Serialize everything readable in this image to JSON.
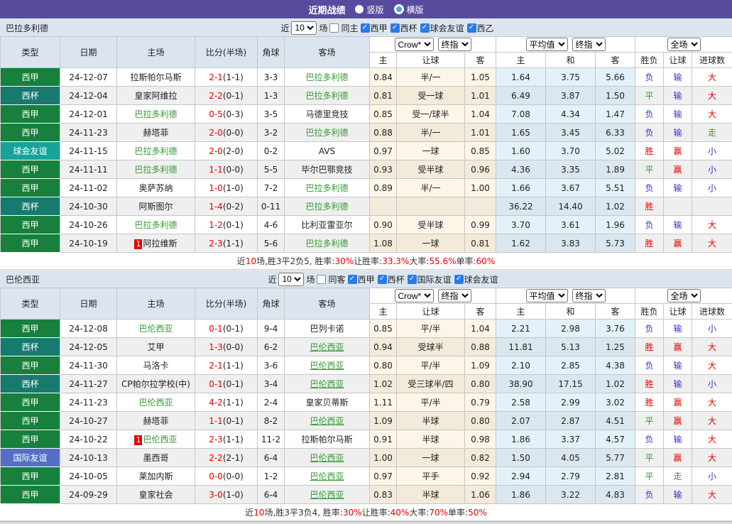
{
  "topbar": {
    "title": "近期战绩",
    "vertical_label": "竖版",
    "horizontal_label": "横版"
  },
  "colors": {
    "accent": "#574b9e",
    "panel": "#dce5ef",
    "xijia": "#16803c",
    "xibei": "#177a6e",
    "qiuhui": "#18a39a",
    "guoji": "#5470c6",
    "team": "#339933",
    "score": "#e60000",
    "win": "#e60000",
    "draw": "#339933",
    "lose": "#3333cc",
    "hwin": "#e60000",
    "hlose": "#3333cc",
    "push": "#339933",
    "over": "#e60000",
    "under": "#3333cc",
    "checkbox": "#2b7be4"
  },
  "tables": [
    {
      "team": "巴拉多利德",
      "filter": {
        "near_label": "近",
        "matches_count": "10",
        "matches_label": "场",
        "same_side_label": "同主",
        "same_side_checked": false,
        "leagues": [
          "西甲",
          "西杯",
          "球会友谊",
          "西乙"
        ]
      },
      "header": {
        "type": "类型",
        "date": "日期",
        "home": "主场",
        "score": "比分(半场)",
        "corner": "角球",
        "away": "客场",
        "crow_select": "Crow*",
        "final_select": "终指",
        "avg_select": "平均值",
        "final_select2": "终指",
        "full_select": "全场",
        "crow_home": "主",
        "crow_handicap": "让球",
        "crow_away": "客",
        "avg_home": "主",
        "avg_draw": "和",
        "avg_away": "客",
        "wdl": "胜负",
        "handicap_result": "让球",
        "goals": "进球数"
      },
      "rows": [
        {
          "type": "西甲",
          "type_key": "xijia",
          "date": "24-12-07",
          "home": "拉斯帕尔马斯",
          "home_hl": false,
          "home_badge": "",
          "score": "2-1",
          "half": "(1-1)",
          "corner": "3-3",
          "away": "巴拉多利德",
          "away_hl": true,
          "away_ul": false,
          "crow_home": "0.84",
          "crow_hcap": "半/一",
          "crow_away": "1.05",
          "avg_home": "1.64",
          "avg_draw": "3.75",
          "avg_away": "5.66",
          "wdl": "负",
          "wdl_key": "lose",
          "hcap": "输",
          "hcap_key": "hlose",
          "goals": "大",
          "goals_key": "over"
        },
        {
          "type": "西杯",
          "type_key": "xibei",
          "date": "24-12-04",
          "home": "皇家阿维拉",
          "home_hl": false,
          "home_badge": "",
          "score": "2-2",
          "half": "(0-1)",
          "corner": "1-3",
          "away": "巴拉多利德",
          "away_hl": true,
          "away_ul": false,
          "crow_home": "0.81",
          "crow_hcap": "受一球",
          "crow_away": "1.01",
          "avg_home": "6.49",
          "avg_draw": "3.87",
          "avg_away": "1.50",
          "wdl": "平",
          "wdl_key": "draw",
          "hcap": "输",
          "hcap_key": "hlose",
          "goals": "大",
          "goals_key": "over"
        },
        {
          "type": "西甲",
          "type_key": "xijia",
          "date": "24-12-01",
          "home": "巴拉多利德",
          "home_hl": true,
          "home_badge": "",
          "score": "0-5",
          "half": "(0-3)",
          "corner": "3-5",
          "away": "马德里竞技",
          "away_hl": false,
          "away_ul": false,
          "crow_home": "0.85",
          "crow_hcap": "受一/球半",
          "crow_away": "1.04",
          "avg_home": "7.08",
          "avg_draw": "4.34",
          "avg_away": "1.47",
          "wdl": "负",
          "wdl_key": "lose",
          "hcap": "输",
          "hcap_key": "hlose",
          "goals": "大",
          "goals_key": "over"
        },
        {
          "type": "西甲",
          "type_key": "xijia",
          "date": "24-11-23",
          "home": "赫塔菲",
          "home_hl": false,
          "home_badge": "",
          "score": "2-0",
          "half": "(0-0)",
          "corner": "3-2",
          "away": "巴拉多利德",
          "away_hl": true,
          "away_ul": false,
          "crow_home": "0.88",
          "crow_hcap": "半/一",
          "crow_away": "1.01",
          "avg_home": "1.65",
          "avg_draw": "3.45",
          "avg_away": "6.33",
          "wdl": "负",
          "wdl_key": "lose",
          "hcap": "输",
          "hcap_key": "hlose",
          "goals": "走",
          "goals_key": "push"
        },
        {
          "type": "球会友谊",
          "type_key": "qiuhui",
          "date": "24-11-15",
          "home": "巴拉多利德",
          "home_hl": true,
          "home_badge": "",
          "score": "2-0",
          "half": "(2-0)",
          "corner": "0-2",
          "away": "AVS",
          "away_hl": false,
          "away_ul": false,
          "crow_home": "0.97",
          "crow_hcap": "一球",
          "crow_away": "0.85",
          "avg_home": "1.60",
          "avg_draw": "3.70",
          "avg_away": "5.02",
          "wdl": "胜",
          "wdl_key": "win",
          "hcap": "赢",
          "hcap_key": "hwin",
          "goals": "小",
          "goals_key": "under"
        },
        {
          "type": "西甲",
          "type_key": "xijia",
          "date": "24-11-11",
          "home": "巴拉多利德",
          "home_hl": true,
          "home_badge": "",
          "score": "1-1",
          "half": "(0-0)",
          "corner": "5-5",
          "away": "毕尔巴鄂竞技",
          "away_hl": false,
          "away_ul": false,
          "crow_home": "0.93",
          "crow_hcap": "受半球",
          "crow_away": "0.96",
          "avg_home": "4.36",
          "avg_draw": "3.35",
          "avg_away": "1.89",
          "wdl": "平",
          "wdl_key": "draw",
          "hcap": "赢",
          "hcap_key": "hwin",
          "goals": "小",
          "goals_key": "under"
        },
        {
          "type": "西甲",
          "type_key": "xijia",
          "date": "24-11-02",
          "home": "奥萨苏纳",
          "home_hl": false,
          "home_badge": "",
          "score": "1-0",
          "half": "(1-0)",
          "corner": "7-2",
          "away": "巴拉多利德",
          "away_hl": true,
          "away_ul": false,
          "crow_home": "0.89",
          "crow_hcap": "半/一",
          "crow_away": "1.00",
          "avg_home": "1.66",
          "avg_draw": "3.67",
          "avg_away": "5.51",
          "wdl": "负",
          "wdl_key": "lose",
          "hcap": "输",
          "hcap_key": "hlose",
          "goals": "小",
          "goals_key": "under"
        },
        {
          "type": "西杯",
          "type_key": "xibei",
          "date": "24-10-30",
          "home": "阿斯图尔",
          "home_hl": false,
          "home_badge": "",
          "score": "1-4",
          "half": "(0-2)",
          "corner": "0-11",
          "away": "巴拉多利德",
          "away_hl": true,
          "away_ul": false,
          "crow_home": "",
          "crow_hcap": "",
          "crow_away": "",
          "avg_home": "36.22",
          "avg_draw": "14.40",
          "avg_away": "1.02",
          "wdl": "胜",
          "wdl_key": "win",
          "hcap": "",
          "hcap_key": "",
          "goals": "",
          "goals_key": ""
        },
        {
          "type": "西甲",
          "type_key": "xijia",
          "date": "24-10-26",
          "home": "巴拉多利德",
          "home_hl": true,
          "home_badge": "",
          "score": "1-2",
          "half": "(0-1)",
          "corner": "4-6",
          "away": "比利亚雷亚尔",
          "away_hl": false,
          "away_ul": false,
          "crow_home": "0.90",
          "crow_hcap": "受半球",
          "crow_away": "0.99",
          "avg_home": "3.70",
          "avg_draw": "3.61",
          "avg_away": "1.96",
          "wdl": "负",
          "wdl_key": "lose",
          "hcap": "输",
          "hcap_key": "hlose",
          "goals": "大",
          "goals_key": "over"
        },
        {
          "type": "西甲",
          "type_key": "xijia",
          "date": "24-10-19",
          "home": "阿拉维斯",
          "home_hl": false,
          "home_badge": "1",
          "score": "2-3",
          "half": "(1-1)",
          "corner": "5-6",
          "away": "巴拉多利德",
          "away_hl": true,
          "away_ul": false,
          "crow_home": "1.08",
          "crow_hcap": "一球",
          "crow_away": "0.81",
          "avg_home": "1.62",
          "avg_draw": "3.83",
          "avg_away": "5.73",
          "wdl": "胜",
          "wdl_key": "win",
          "hcap": "赢",
          "hcap_key": "hwin",
          "goals": "大",
          "goals_key": "over"
        }
      ],
      "summary": [
        {
          "text": "近",
          "red": false
        },
        {
          "text": "10",
          "red": true
        },
        {
          "text": "场,胜3平2负5, 胜率:",
          "red": false
        },
        {
          "text": "30%",
          "red": true
        },
        {
          "text": " 让胜率:",
          "red": false
        },
        {
          "text": "33.3%",
          "red": true
        },
        {
          "text": " 大率:",
          "red": false
        },
        {
          "text": "55.6%",
          "red": true
        },
        {
          "text": " 单率:",
          "red": false
        },
        {
          "text": "60%",
          "red": true
        }
      ]
    },
    {
      "team": "巴伦西亚",
      "filter": {
        "near_label": "近",
        "matches_count": "10",
        "matches_label": "场",
        "same_side_label": "同客",
        "same_side_checked": false,
        "leagues": [
          "西甲",
          "西杯",
          "国际友谊",
          "球会友谊"
        ]
      },
      "header": {
        "type": "类型",
        "date": "日期",
        "home": "主场",
        "score": "比分(半场)",
        "corner": "角球",
        "away": "客场",
        "crow_select": "Crow*",
        "final_select": "终指",
        "avg_select": "平均值",
        "final_select2": "终指",
        "full_select": "全场",
        "crow_home": "主",
        "crow_handicap": "让球",
        "crow_away": "客",
        "avg_home": "主",
        "avg_draw": "和",
        "avg_away": "客",
        "wdl": "胜负",
        "handicap_result": "让球",
        "goals": "进球数"
      },
      "rows": [
        {
          "type": "西甲",
          "type_key": "xijia",
          "date": "24-12-08",
          "home": "巴伦西亚",
          "home_hl": true,
          "home_badge": "",
          "score": "0-1",
          "half": "(0-1)",
          "corner": "9-4",
          "away": "巴列卡诺",
          "away_hl": false,
          "away_ul": false,
          "crow_home": "0.85",
          "crow_hcap": "平/半",
          "crow_away": "1.04",
          "avg_home": "2.21",
          "avg_draw": "2.98",
          "avg_away": "3.76",
          "wdl": "负",
          "wdl_key": "lose",
          "hcap": "输",
          "hcap_key": "hlose",
          "goals": "小",
          "goals_key": "under"
        },
        {
          "type": "西杯",
          "type_key": "xibei",
          "date": "24-12-05",
          "home": "艾甲",
          "home_hl": false,
          "home_badge": "",
          "score": "1-3",
          "half": "(0-0)",
          "corner": "6-2",
          "away": "巴伦西亚",
          "away_hl": true,
          "away_ul": true,
          "crow_home": "0.94",
          "crow_hcap": "受球半",
          "crow_away": "0.88",
          "avg_home": "11.81",
          "avg_draw": "5.13",
          "avg_away": "1.25",
          "wdl": "胜",
          "wdl_key": "win",
          "hcap": "赢",
          "hcap_key": "hwin",
          "goals": "大",
          "goals_key": "over"
        },
        {
          "type": "西甲",
          "type_key": "xijia",
          "date": "24-11-30",
          "home": "马洛卡",
          "home_hl": false,
          "home_badge": "",
          "score": "2-1",
          "half": "(1-1)",
          "corner": "3-6",
          "away": "巴伦西亚",
          "away_hl": true,
          "away_ul": true,
          "crow_home": "0.80",
          "crow_hcap": "平/半",
          "crow_away": "1.09",
          "avg_home": "2.10",
          "avg_draw": "2.85",
          "avg_away": "4.38",
          "wdl": "负",
          "wdl_key": "lose",
          "hcap": "输",
          "hcap_key": "hlose",
          "goals": "大",
          "goals_key": "over"
        },
        {
          "type": "西杯",
          "type_key": "xibei",
          "date": "24-11-27",
          "home": "CP帕尔拉学校(中)",
          "home_hl": false,
          "home_badge": "",
          "score": "0-1",
          "half": "(0-1)",
          "corner": "3-4",
          "away": "巴伦西亚",
          "away_hl": true,
          "away_ul": true,
          "crow_home": "1.02",
          "crow_hcap": "受三球半/四",
          "crow_away": "0.80",
          "avg_home": "38.90",
          "avg_draw": "17.15",
          "avg_away": "1.02",
          "wdl": "胜",
          "wdl_key": "win",
          "hcap": "输",
          "hcap_key": "hlose",
          "goals": "小",
          "goals_key": "under"
        },
        {
          "type": "西甲",
          "type_key": "xijia",
          "date": "24-11-23",
          "home": "巴伦西亚",
          "home_hl": true,
          "home_badge": "",
          "score": "4-2",
          "half": "(1-1)",
          "corner": "2-4",
          "away": "皇家贝蒂斯",
          "away_hl": false,
          "away_ul": false,
          "crow_home": "1.11",
          "crow_hcap": "平/半",
          "crow_away": "0.79",
          "avg_home": "2.58",
          "avg_draw": "2.99",
          "avg_away": "3.02",
          "wdl": "胜",
          "wdl_key": "win",
          "hcap": "赢",
          "hcap_key": "hwin",
          "goals": "大",
          "goals_key": "over"
        },
        {
          "type": "西甲",
          "type_key": "xijia",
          "date": "24-10-27",
          "home": "赫塔菲",
          "home_hl": false,
          "home_badge": "",
          "score": "1-1",
          "half": "(0-1)",
          "corner": "8-2",
          "away": "巴伦西亚",
          "away_hl": true,
          "away_ul": true,
          "crow_home": "1.09",
          "crow_hcap": "半球",
          "crow_away": "0.80",
          "avg_home": "2.07",
          "avg_draw": "2.87",
          "avg_away": "4.51",
          "wdl": "平",
          "wdl_key": "draw",
          "hcap": "赢",
          "hcap_key": "hwin",
          "goals": "大",
          "goals_key": "over"
        },
        {
          "type": "西甲",
          "type_key": "xijia",
          "date": "24-10-22",
          "home": "巴伦西亚",
          "home_hl": true,
          "home_badge": "1",
          "score": "2-3",
          "half": "(1-1)",
          "corner": "11-2",
          "away": "拉斯帕尔马斯",
          "away_hl": false,
          "away_ul": false,
          "crow_home": "0.91",
          "crow_hcap": "半球",
          "crow_away": "0.98",
          "avg_home": "1.86",
          "avg_draw": "3.37",
          "avg_away": "4.57",
          "wdl": "负",
          "wdl_key": "lose",
          "hcap": "输",
          "hcap_key": "hlose",
          "goals": "大",
          "goals_key": "over"
        },
        {
          "type": "国际友谊",
          "type_key": "guoji",
          "date": "24-10-13",
          "home": "墨西哥",
          "home_hl": false,
          "home_badge": "",
          "score": "2-2",
          "half": "(2-1)",
          "corner": "6-4",
          "away": "巴伦西亚",
          "away_hl": true,
          "away_ul": true,
          "crow_home": "1.00",
          "crow_hcap": "一球",
          "crow_away": "0.82",
          "avg_home": "1.50",
          "avg_draw": "4.05",
          "avg_away": "5.77",
          "wdl": "平",
          "wdl_key": "draw",
          "hcap": "赢",
          "hcap_key": "hwin",
          "goals": "大",
          "goals_key": "over"
        },
        {
          "type": "西甲",
          "type_key": "xijia",
          "date": "24-10-05",
          "home": "莱加内斯",
          "home_hl": false,
          "home_badge": "",
          "score": "0-0",
          "half": "(0-0)",
          "corner": "1-2",
          "away": "巴伦西亚",
          "away_hl": true,
          "away_ul": true,
          "crow_home": "0.97",
          "crow_hcap": "平手",
          "crow_away": "0.92",
          "avg_home": "2.94",
          "avg_draw": "2.79",
          "avg_away": "2.81",
          "wdl": "平",
          "wdl_key": "draw",
          "hcap": "走",
          "hcap_key": "push",
          "goals": "小",
          "goals_key": "under"
        },
        {
          "type": "西甲",
          "type_key": "xijia",
          "date": "24-09-29",
          "home": "皇家社会",
          "home_hl": false,
          "home_badge": "",
          "score": "3-0",
          "half": "(1-0)",
          "corner": "6-4",
          "away": "巴伦西亚",
          "away_hl": true,
          "away_ul": true,
          "crow_home": "0.83",
          "crow_hcap": "半球",
          "crow_away": "1.06",
          "avg_home": "1.86",
          "avg_draw": "3.22",
          "avg_away": "4.83",
          "wdl": "负",
          "wdl_key": "lose",
          "hcap": "输",
          "hcap_key": "hlose",
          "goals": "大",
          "goals_key": "over"
        }
      ],
      "summary": [
        {
          "text": "近",
          "red": false
        },
        {
          "text": "10",
          "red": true
        },
        {
          "text": "场,胜3平3负4, 胜率:",
          "red": false
        },
        {
          "text": "30%",
          "red": true
        },
        {
          "text": " 让胜率:",
          "red": false
        },
        {
          "text": "40%",
          "red": true
        },
        {
          "text": " 大率:",
          "red": false
        },
        {
          "text": "70%",
          "red": true
        },
        {
          "text": " 单率:",
          "red": false
        },
        {
          "text": "50%",
          "red": true
        }
      ]
    }
  ]
}
